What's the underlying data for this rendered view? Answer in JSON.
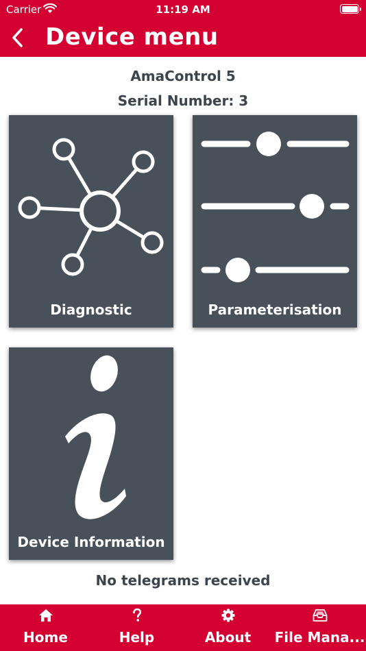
{
  "status_bar": {
    "carrier": "Carrier",
    "time": "11:19 AM"
  },
  "header": {
    "title": "Device menu"
  },
  "device": {
    "name": "AmaControl 5",
    "serial": "Serial Number: 3"
  },
  "tiles": [
    {
      "label": "Diagnostic",
      "icon": "network-hub-icon"
    },
    {
      "label": "Parameterisation",
      "icon": "sliders-icon"
    },
    {
      "label": "Device Information",
      "icon": "info-icon"
    }
  ],
  "status_message": "No telegrams received",
  "tabbar": {
    "items": [
      {
        "label": "Home",
        "icon": "home-icon"
      },
      {
        "label": "Help",
        "icon": "question-icon"
      },
      {
        "label": "About",
        "icon": "gear-icon"
      },
      {
        "label": "File Mana...",
        "icon": "inbox-tray-icon"
      }
    ]
  },
  "colors": {
    "brand": "#d50032",
    "tile": "#48505a",
    "text": "#3d444b"
  }
}
